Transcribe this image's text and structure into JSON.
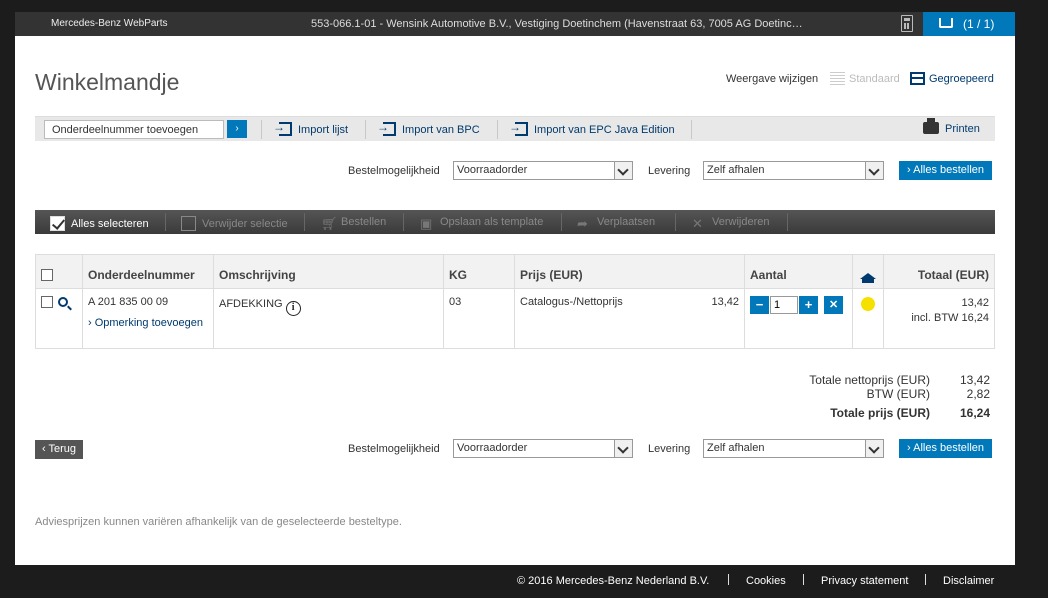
{
  "header": {
    "brand": "Mercedes-Benz WebParts",
    "dealer": "553-066.1-01 - Wensink Automotive B.V., Vestiging Doetinchem (Havenstraat 63, 7005 AG Doetinc…",
    "calculator_icon": "calculator-icon",
    "cart_count": "(1 / 1)"
  },
  "page": {
    "title": "Winkelmandje",
    "view_label": "Weergave wijzigen",
    "view_standard": "Standaard",
    "view_grouped": "Gegroepeerd"
  },
  "toolbar": {
    "add_part_placeholder": "Onderdeelnummer toevoegen",
    "go_label": "›",
    "import_list": "Import lijst",
    "import_bpc": "Import van BPC",
    "import_epc": "Import van EPC Java Edition",
    "print": "Printen"
  },
  "order_options": {
    "order_type_label": "Bestelmogelijkheid",
    "order_type_value": "Voorraadorder",
    "delivery_label": "Levering",
    "delivery_value": "Zelf afhalen",
    "order_all": "› Alles bestellen"
  },
  "actions": {
    "select_all": "Alles selecteren",
    "delete_selection": "Verwijder selectie",
    "order": "Bestellen",
    "save_template": "Opslaan als template",
    "move": "Verplaatsen",
    "delete": "Verwijderen"
  },
  "table": {
    "headers": {
      "part_number": "Onderdeelnummer",
      "description": "Omschrijving",
      "kg": "KG",
      "price": "Prijs (EUR)",
      "quantity": "Aantal",
      "total": "Totaal (EUR)"
    },
    "rows": [
      {
        "part_number": "A 201 835 00 09",
        "remark": "› Opmerking toevoegen",
        "description": "AFDEKKING",
        "kg": "03",
        "price_type": "Catalogus-/Nettoprijs",
        "price": "13,42",
        "quantity": "1",
        "total": "13,42",
        "total_incl": "incl. BTW 16,24",
        "availability_color": "#f5e000"
      }
    ]
  },
  "totals": {
    "net_label": "Totale nettoprijs (EUR)",
    "net_value": "13,42",
    "vat_label": "BTW (EUR)",
    "vat_value": "2,82",
    "total_label": "Totale prijs (EUR)",
    "total_value": "16,24"
  },
  "back_button": "‹ Terug",
  "disclaimer": "Adviesprijzen kunnen variëren afhankelijk van de geselecteerde besteltype.",
  "footer": {
    "copyright": "© 2016 Mercedes-Benz Nederland B.V.",
    "cookies": "Cookies",
    "privacy": "Privacy statement",
    "disclaimer": "Disclaimer"
  },
  "colors": {
    "accent": "#0078b9",
    "link": "#003a6e",
    "topbar": "#333333",
    "background": "#1c1c1c"
  }
}
